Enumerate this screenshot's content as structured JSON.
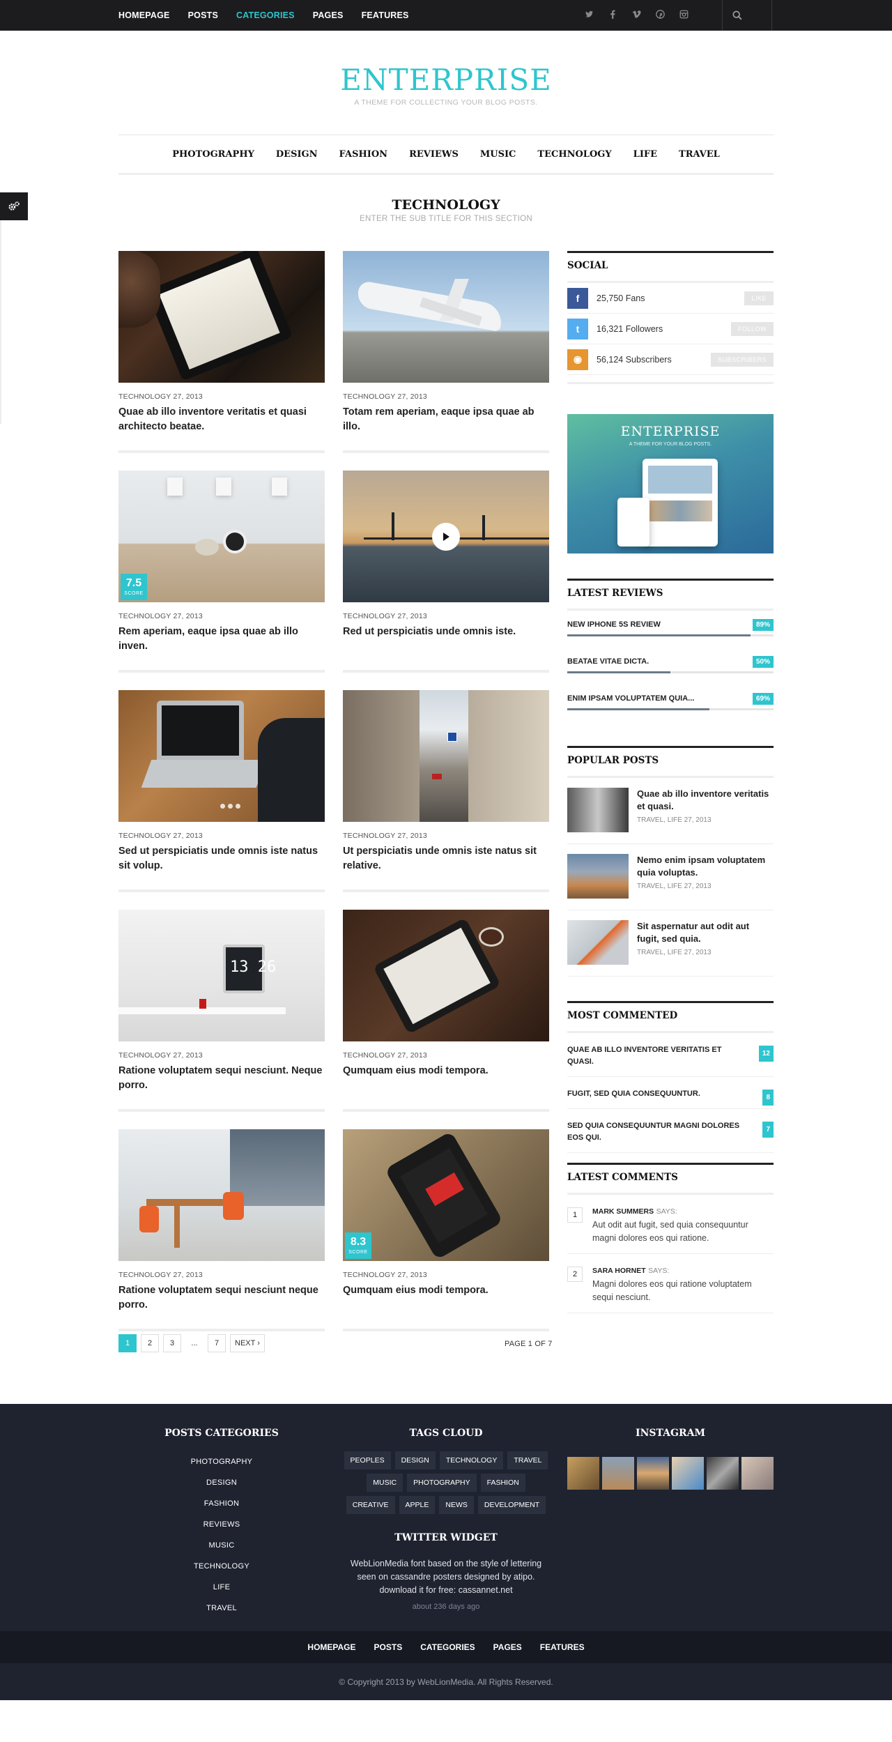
{
  "topnav": [
    "HOMEPAGE",
    "POSTS",
    "CATEGORIES",
    "PAGES",
    "FEATURES"
  ],
  "active_nav": "CATEGORIES",
  "social_icons": [
    "twitter-icon",
    "facebook-icon",
    "vimeo-icon",
    "pinterest-icon",
    "instagram-icon"
  ],
  "brand": {
    "title": "ENTERPRISE",
    "tagline": "A THEME FOR COLLECTING YOUR BLOG POSTS."
  },
  "catnav": [
    "PHOTOGRAPHY",
    "DESIGN",
    "FASHION",
    "REVIEWS",
    "MUSIC",
    "TECHNOLOGY",
    "LIFE",
    "TRAVEL"
  ],
  "section": {
    "title": "TECHNOLOGY",
    "subtitle": "ENTER THE SUB TITLE FOR THIS SECTION"
  },
  "posts": [
    {
      "meta": "TECHNOLOGY 27, 2013",
      "title": "Quae ab illo inventore veritatis et quasi architecto beatae."
    },
    {
      "meta": "TECHNOLOGY 27, 2013",
      "title": "Totam rem aperiam, eaque ipsa quae ab illo."
    },
    {
      "meta": "TECHNOLOGY 27, 2013",
      "title": "Rem aperiam, eaque ipsa quae ab illo inven.",
      "score": "7.5",
      "score_label": "SCORE"
    },
    {
      "meta": "TECHNOLOGY 27, 2013",
      "title": "Red ut perspiciatis unde omnis iste."
    },
    {
      "meta": "TECHNOLOGY 27, 2013",
      "title": "Sed ut perspiciatis unde omnis iste natus sit volup."
    },
    {
      "meta": "TECHNOLOGY 27, 2013",
      "title": "Ut perspiciatis unde omnis iste natus sit relative."
    },
    {
      "meta": "TECHNOLOGY 27, 2013",
      "title": "Ratione voluptatem sequi nesciunt. Neque porro."
    },
    {
      "meta": "TECHNOLOGY 27, 2013",
      "title": "Qumquam eius modi tempora."
    },
    {
      "meta": "TECHNOLOGY 27, 2013",
      "title": "Ratione voluptatem sequi nesciunt neque porro."
    },
    {
      "meta": "TECHNOLOGY 27, 2013",
      "title": "Qumquam eius modi tempora.",
      "score": "8.3",
      "score_label": "SCORE"
    }
  ],
  "pagination": {
    "pages": [
      "1",
      "2",
      "3",
      "...",
      "7"
    ],
    "next": "NEXT ›",
    "info": "PAGE 1 OF 7"
  },
  "sidebar": {
    "social": {
      "title": "SOCIAL",
      "items": [
        {
          "icon": "facebook-icon",
          "glyph": "f",
          "color": "#3b5998",
          "text": "25,750 Fans",
          "btn": "LIKE"
        },
        {
          "icon": "twitter-icon",
          "glyph": "t",
          "color": "#55acee",
          "text": "16,321 Followers",
          "btn": "FOLLOW"
        },
        {
          "icon": "rss-icon",
          "glyph": "◉",
          "color": "#e69530",
          "text": "56,124 Subscribers",
          "btn": "SUBSCRIBERS"
        }
      ]
    },
    "banner": {
      "title": "ENTERPRISE",
      "tag": "A THEME FOR YOUR BLOG POSTS."
    },
    "reviews": {
      "title": "LATEST REVIEWS",
      "items": [
        {
          "name": "NEW IPHONE 5S REVIEW",
          "pct": "89%",
          "fill": 0.89
        },
        {
          "name": "BEATAE VITAE DICTA.",
          "pct": "50%",
          "fill": 0.5
        },
        {
          "name": "ENIM IPSAM VOLUPTATEM QUIA...",
          "pct": "69%",
          "fill": 0.69
        }
      ]
    },
    "popular": {
      "title": "POPULAR POSTS",
      "items": [
        {
          "title": "Quae ab illo inventore veritatis et quasi.",
          "meta": "TRAVEL, LIFE 27, 2013"
        },
        {
          "title": "Nemo enim ipsam voluptatem quia voluptas.",
          "meta": "TRAVEL, LIFE 27, 2013"
        },
        {
          "title": "Sit aspernatur aut odit aut fugit, sed quia.",
          "meta": "TRAVEL, LIFE 27, 2013"
        }
      ]
    },
    "commented": {
      "title": "MOST COMMENTED",
      "items": [
        {
          "title": "QUAE AB ILLO INVENTORE VERITATIS ET QUASI.",
          "count": "12"
        },
        {
          "title": "FUGIT, SED QUIA CONSEQUUNTUR.",
          "count": "8"
        },
        {
          "title": "SED QUIA CONSEQUUNTUR MAGNI DOLORES EOS QUI.",
          "count": "7"
        }
      ]
    },
    "comments": {
      "title": "LATEST COMMENTS",
      "items": [
        {
          "n": "1",
          "author": "MARK SUMMERS",
          "says": "SAYS:",
          "text": "Aut odit aut fugit, sed quia consequuntur magni dolores eos qui ratione."
        },
        {
          "n": "2",
          "author": "SARA HORNET",
          "says": "SAYS:",
          "text": "Magni dolores eos qui ratione voluptatem sequi nesciunt."
        }
      ]
    }
  },
  "footer": {
    "cats_title": "POSTS CATEGORIES",
    "cats": [
      "PHOTOGRAPHY",
      "DESIGN",
      "FASHION",
      "REVIEWS",
      "MUSIC",
      "TECHNOLOGY",
      "LIFE",
      "TRAVEL"
    ],
    "tags_title": "TAGS CLOUD",
    "tags": [
      "PEOPLES",
      "DESIGN",
      "TECHNOLOGY",
      "TRAVEL",
      "MUSIC",
      "PHOTOGRAPHY",
      "FASHION",
      "CREATIVE",
      "APPLE",
      "NEWS",
      "DEVELOPMENT"
    ],
    "twitter_title": "TWITTER WIDGET",
    "tweet": "WebLionMedia font based on the style of lettering seen on cassandre posters designed by atipo. download it for free: cassannet.net",
    "tweet_time": "about 236 days ago",
    "insta_title": "INSTAGRAM",
    "nav": [
      "HOMEPAGE",
      "POSTS",
      "CATEGORIES",
      "PAGES",
      "FEATURES"
    ],
    "copyright": "© Copyright 2013 by WebLionMedia. All Rights Reserved."
  },
  "colors": {
    "accent": "#2ec5ce",
    "topbar": "#1c1c1e",
    "footer": "#1f2330"
  }
}
